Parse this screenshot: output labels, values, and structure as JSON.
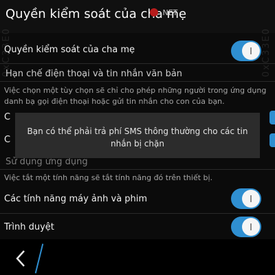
{
  "header": {
    "title": "Quyền kiểm soát của cha mẹ",
    "watermark_prefix": "",
    "watermark_accent": "",
    "watermark_suffix": ".NET"
  },
  "settings": {
    "parental_control": {
      "label": "Quyền kiểm soát của cha mẹ",
      "on": true
    },
    "section_calls_texts": "Hạn chế điện thoại và tin nhắn văn bản",
    "calls_texts_desc": "Việc chọn một tùy chọn sẽ chỉ cho phép những người trong ứng dụng danh bạ gọi điện thoại hoặc gửi tin nhắn cho con của bạn.",
    "clipped_row_1": "C",
    "clipped_row_2": "C",
    "section_app_usage": "Sử dụng ứng dụng",
    "app_usage_desc": "Việc tắt một tính năng sẽ tắt tính năng đó trên thiết bị.",
    "camera_video": {
      "label": "Các tính năng máy ảnh và phim",
      "on": true
    },
    "browser": {
      "label": "Trình duyệt",
      "on": true
    }
  },
  "toast": {
    "message": "Bạn có thể phải trả phí SMS thông thường cho các tin nhắn bị chặn"
  },
  "side_watermark": "0xC33E0",
  "colors": {
    "accent": "#2f8fd1",
    "background": "#0b0b0b",
    "toast": "#2c2c2c"
  },
  "icons": {
    "back": "chevron-left-icon"
  }
}
